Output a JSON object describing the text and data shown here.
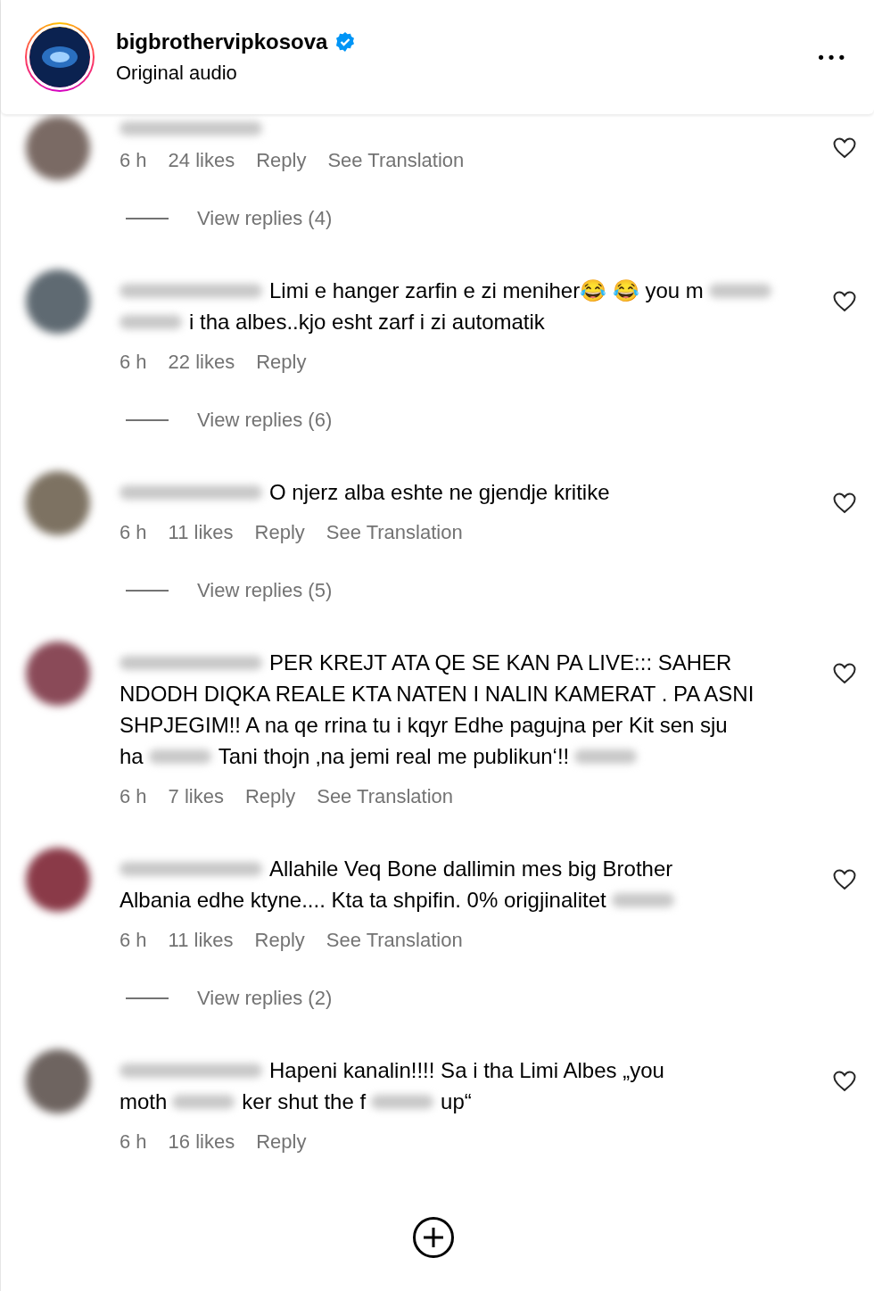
{
  "header": {
    "username": "bigbrothervipkosova",
    "verified": true,
    "subtitle": "Original audio",
    "more": "•••"
  },
  "comments": [
    {
      "avatar": {
        "color": "#7a6a64"
      },
      "lines": [
        [
          {
            "kind": "username_blur"
          }
        ]
      ],
      "time": "6 h",
      "likes": "24 likes",
      "actions": [
        "Reply",
        "See Translation"
      ],
      "replies": "View replies (4)"
    },
    {
      "avatar": {
        "color": "#5f6a72"
      },
      "lines": [
        [
          {
            "kind": "username_blur"
          },
          {
            "kind": "text",
            "text": "Limi e hanger zarfin e zi meniher😂 😂 you m"
          },
          {
            "kind": "blur"
          }
        ],
        [
          {
            "kind": "blur"
          },
          {
            "kind": "text",
            "text": "i tha albes..kjo esht zarf i zi automatik"
          }
        ]
      ],
      "time": "6 h",
      "likes": "22 likes",
      "actions": [
        "Reply"
      ],
      "replies": "View replies (6)"
    },
    {
      "avatar": {
        "color": "#7d7262"
      },
      "lines": [
        [
          {
            "kind": "username_blur"
          },
          {
            "kind": "text",
            "text": "O njerz alba eshte ne gjendje kritike"
          }
        ]
      ],
      "time": "6 h",
      "likes": "11 likes",
      "actions": [
        "Reply",
        "See Translation"
      ],
      "replies": "View replies (5)"
    },
    {
      "avatar": {
        "color": "#8a4a58"
      },
      "lines": [
        [
          {
            "kind": "username_blur"
          },
          {
            "kind": "text",
            "text": "PER KREJT ATA QE SE KAN PA LIVE::: SAHER"
          }
        ],
        [
          {
            "kind": "text",
            "text": "NDODH DIQKA REALE KTA NATEN I NALIN KAMERAT . PA ASNI"
          }
        ],
        [
          {
            "kind": "text",
            "text": "SHPJEGIM!! A na qe rrina tu i kqyr Edhe pagujna per Kit sen sju"
          }
        ],
        [
          {
            "kind": "text",
            "text": "ha"
          },
          {
            "kind": "blur"
          },
          {
            "kind": "text",
            "text": "Tani thojn ‚na jemi real me publikun‘!!"
          },
          {
            "kind": "blur"
          }
        ]
      ],
      "time": "6 h",
      "likes": "7 likes",
      "actions": [
        "Reply",
        "See Translation"
      ]
    },
    {
      "avatar": {
        "color": "#8a3a48"
      },
      "lines": [
        [
          {
            "kind": "username_blur"
          },
          {
            "kind": "text",
            "text": "Allahile Veq Bone dallimin mes big Brother"
          }
        ],
        [
          {
            "kind": "text",
            "text": "Albania edhe ktyne.... Kta ta shpifin. 0% origjinalitet"
          },
          {
            "kind": "blur"
          }
        ]
      ],
      "time": "6 h",
      "likes": "11 likes",
      "actions": [
        "Reply",
        "See Translation"
      ],
      "replies": "View replies (2)"
    },
    {
      "avatar": {
        "color": "#6e6460"
      },
      "lines": [
        [
          {
            "kind": "username_blur"
          },
          {
            "kind": "text",
            "text": "Hapeni kanalin!!!! Sa i tha Limi Albes „you"
          }
        ],
        [
          {
            "kind": "text",
            "text": "moth"
          },
          {
            "kind": "blur"
          },
          {
            "kind": "text",
            "text": "ker shut the f"
          },
          {
            "kind": "blur"
          },
          {
            "kind": "text",
            "text": "up“"
          }
        ]
      ],
      "time": "6 h",
      "likes": "16 likes",
      "actions": [
        "Reply"
      ]
    }
  ]
}
